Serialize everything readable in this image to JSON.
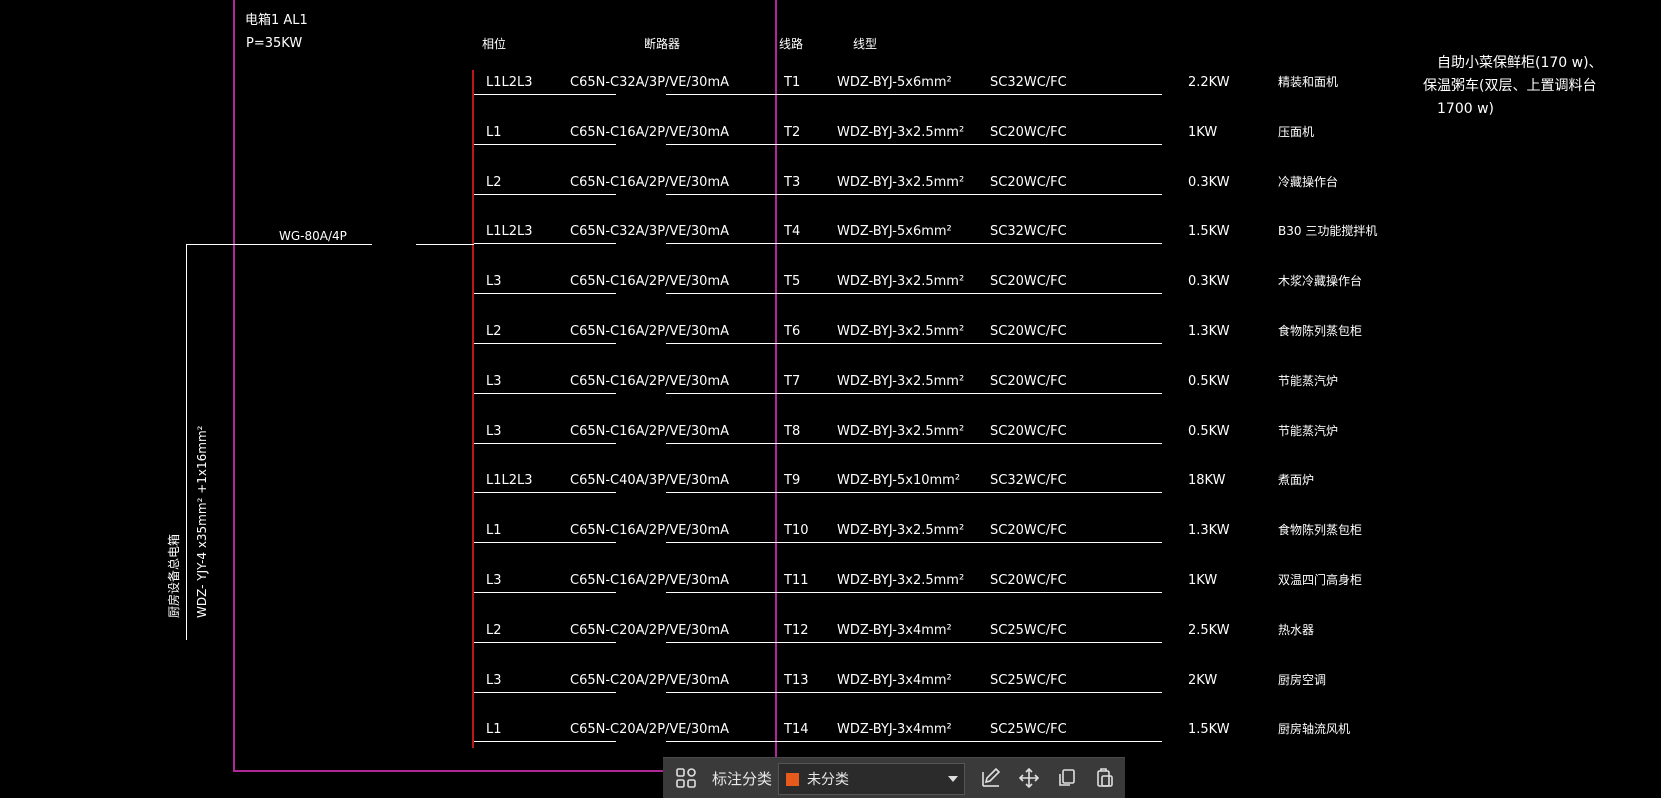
{
  "panel": {
    "title": "电箱1  AL1",
    "power": "P=35KW"
  },
  "headers": {
    "phase": "相位",
    "breaker": "断路器",
    "circuit": "线路",
    "cable": "线型"
  },
  "incoming": {
    "switch": "WG-80A/4P",
    "cable": "WDZ- YJY-4 x35mm² +1x16mm²",
    "label": "厨房设备总电箱"
  },
  "note": {
    "line1": "自助小菜保鲜柜(170 w)、",
    "line2": "保温粥车(双层、上置调料台",
    "line3": "1700 w)"
  },
  "rows": [
    {
      "phase": "L1L2L3",
      "breaker": "C65N-C32A/3P/VE/30mA",
      "circuit": "T1",
      "cable": "WDZ-BYJ-5x6mm²",
      "conduit": "SC32WC/FC",
      "power": "2.2KW",
      "load": "精装和面机"
    },
    {
      "phase": "L1",
      "breaker": "C65N-C16A/2P/VE/30mA",
      "circuit": "T2",
      "cable": "WDZ-BYJ-3x2.5mm²",
      "conduit": "SC20WC/FC",
      "power": "1KW",
      "load": "压面机"
    },
    {
      "phase": "L2",
      "breaker": "C65N-C16A/2P/VE/30mA",
      "circuit": "T3",
      "cable": "WDZ-BYJ-3x2.5mm²",
      "conduit": "SC20WC/FC",
      "power": "0.3KW",
      "load": "冷藏操作台"
    },
    {
      "phase": "L1L2L3",
      "breaker": "C65N-C32A/3P/VE/30mA",
      "circuit": "T4",
      "cable": "WDZ-BYJ-5x6mm²",
      "conduit": "SC32WC/FC",
      "power": "1.5KW",
      "load": "B30  三功能搅拌机"
    },
    {
      "phase": "L3",
      "breaker": "C65N-C16A/2P/VE/30mA",
      "circuit": "T5",
      "cable": "WDZ-BYJ-3x2.5mm²",
      "conduit": "SC20WC/FC",
      "power": "0.3KW",
      "load": "木浆冷藏操作台"
    },
    {
      "phase": "L2",
      "breaker": "C65N-C16A/2P/VE/30mA",
      "circuit": "T6",
      "cable": "WDZ-BYJ-3x2.5mm²",
      "conduit": "SC20WC/FC",
      "power": "1.3KW",
      "load": "食物陈列蒸包柜"
    },
    {
      "phase": "L3",
      "breaker": "C65N-C16A/2P/VE/30mA",
      "circuit": "T7",
      "cable": "WDZ-BYJ-3x2.5mm²",
      "conduit": "SC20WC/FC",
      "power": "0.5KW",
      "load": "节能蒸汽炉"
    },
    {
      "phase": "L3",
      "breaker": "C65N-C16A/2P/VE/30mA",
      "circuit": "T8",
      "cable": "WDZ-BYJ-3x2.5mm²",
      "conduit": "SC20WC/FC",
      "power": "0.5KW",
      "load": "节能蒸汽炉"
    },
    {
      "phase": "L1L2L3",
      "breaker": "C65N-C40A/3P/VE/30mA",
      "circuit": "T9",
      "cable": "WDZ-BYJ-5x10mm²",
      "conduit": "SC32WC/FC",
      "power": "18KW",
      "load": "煮面炉"
    },
    {
      "phase": "L1",
      "breaker": "C65N-C16A/2P/VE/30mA",
      "circuit": "T10",
      "cable": "WDZ-BYJ-3x2.5mm²",
      "conduit": "SC20WC/FC",
      "power": "1.3KW",
      "load": "食物陈列蒸包柜"
    },
    {
      "phase": "L3",
      "breaker": "C65N-C16A/2P/VE/30mA",
      "circuit": "T11",
      "cable": "WDZ-BYJ-3x2.5mm²",
      "conduit": "SC20WC/FC",
      "power": "1KW",
      "load": "双温四门高身柜"
    },
    {
      "phase": "L2",
      "breaker": "C65N-C20A/2P/VE/30mA",
      "circuit": "T12",
      "cable": "WDZ-BYJ-3x4mm²",
      "conduit": "SC25WC/FC",
      "power": "2.5KW",
      "load": "热水器"
    },
    {
      "phase": "L3",
      "breaker": "C65N-C20A/2P/VE/30mA",
      "circuit": "T13",
      "cable": "WDZ-BYJ-3x4mm²",
      "conduit": "SC25WC/FC",
      "power": "2KW",
      "load": "厨房空调"
    },
    {
      "phase": "L1",
      "breaker": "C65N-C20A/2P/VE/30mA",
      "circuit": "T14",
      "cable": "WDZ-BYJ-3x4mm²",
      "conduit": "SC25WC/FC",
      "power": "1.5KW",
      "load": "厨房轴流风机"
    }
  ],
  "toolbar": {
    "grid_icon": "grid-icon",
    "label": "标注分类",
    "select_value": "未分类",
    "swatch_color": "#e85a1c",
    "icons": [
      "edit-icon",
      "move-icon",
      "copy-icon",
      "paste-icon"
    ]
  }
}
